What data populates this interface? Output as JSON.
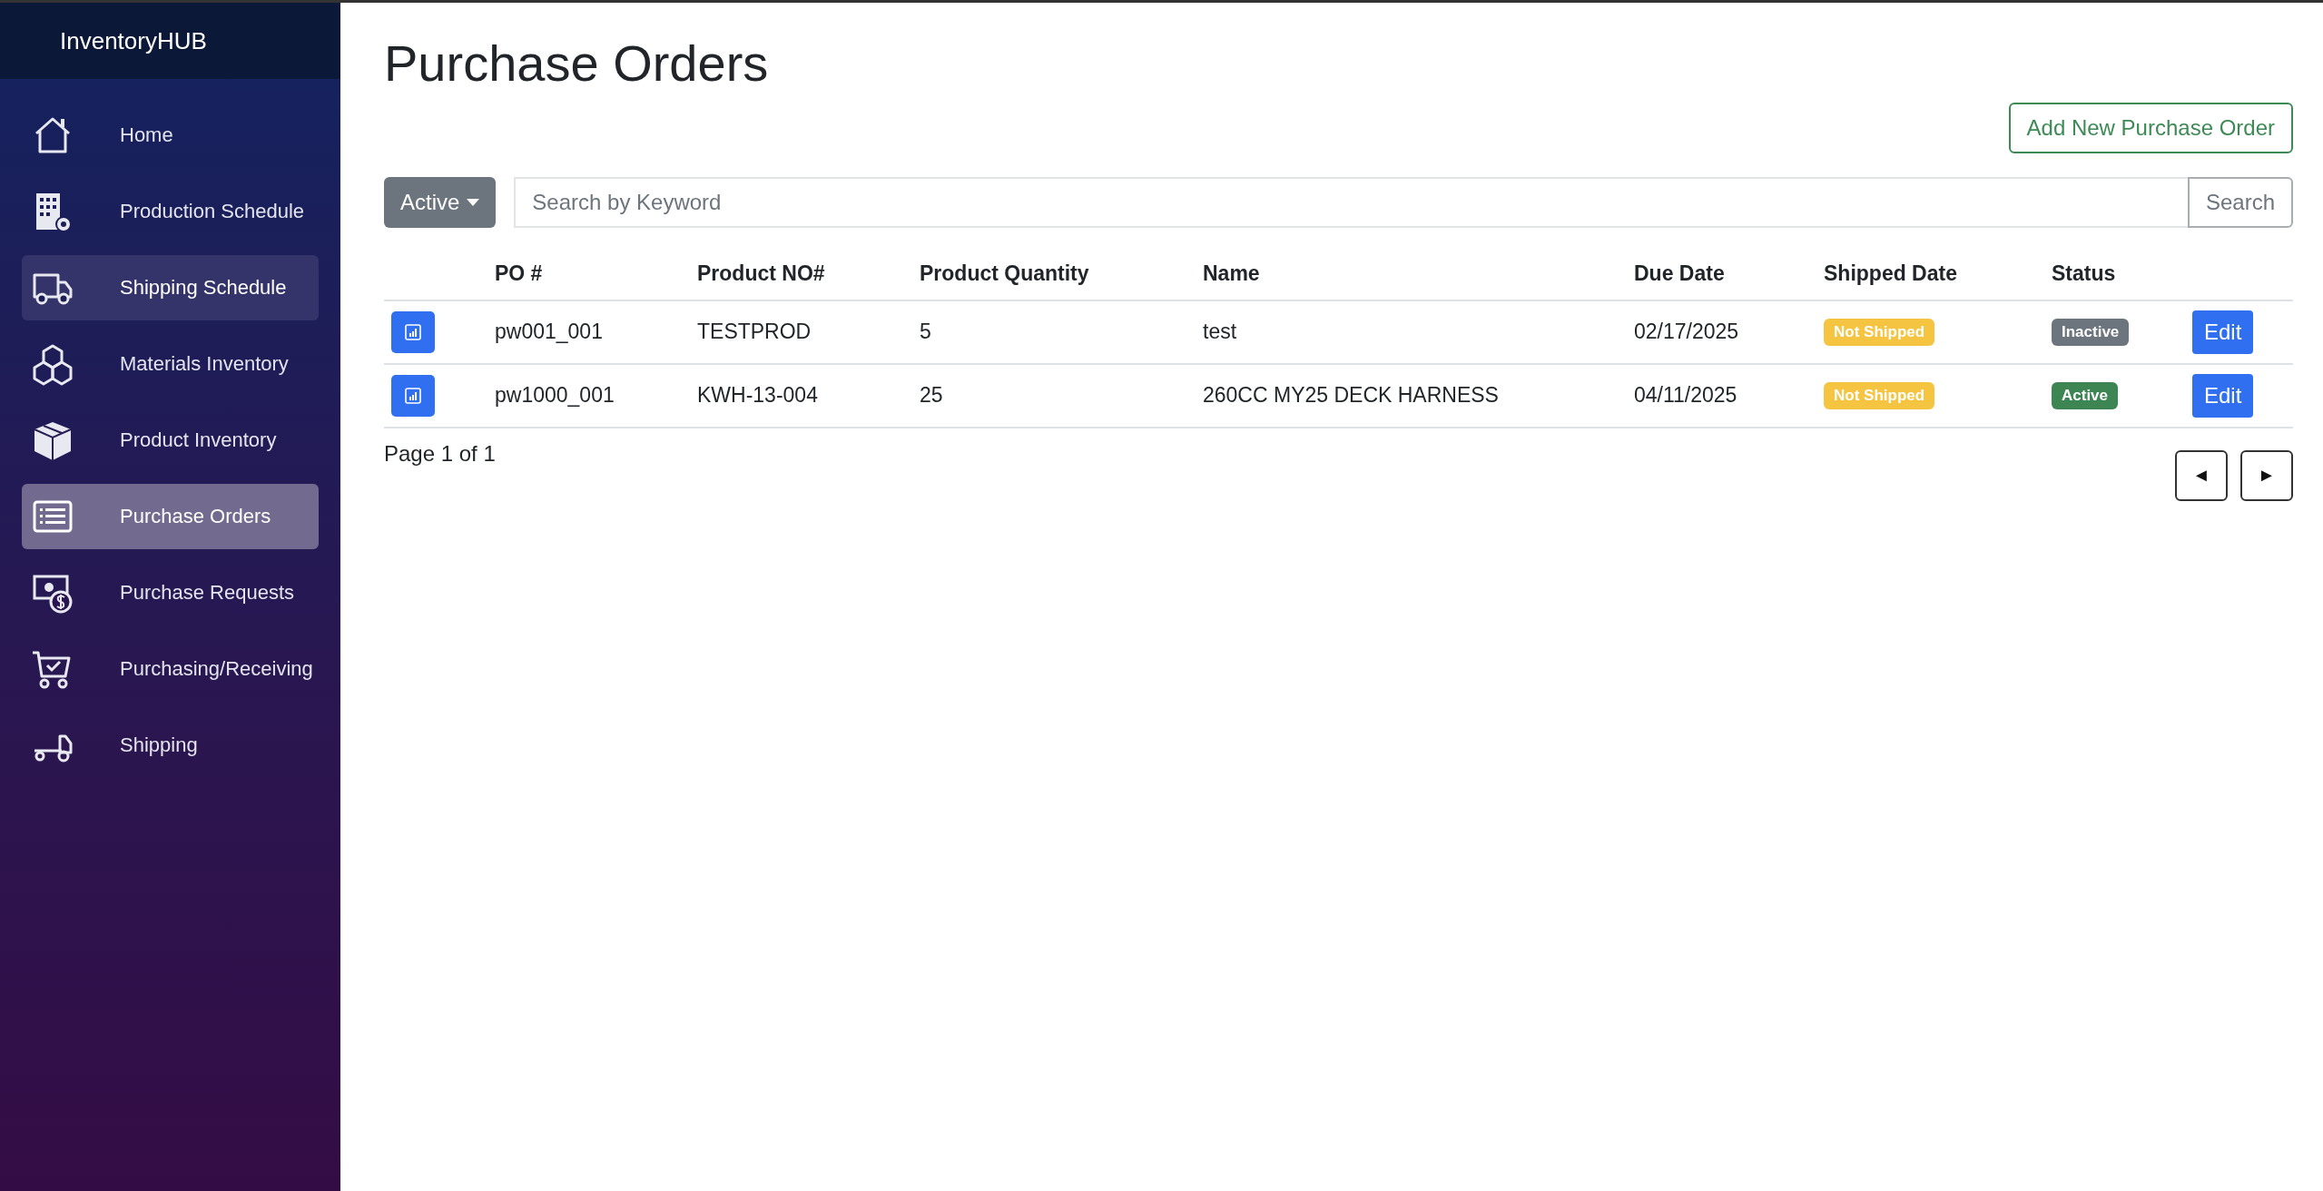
{
  "sidebar": {
    "brand": "InventoryHUB",
    "items": [
      {
        "label": "Home",
        "selected": false,
        "hovered": false
      },
      {
        "label": "Production Schedule",
        "selected": false,
        "hovered": false
      },
      {
        "label": "Shipping Schedule",
        "selected": false,
        "hovered": true
      },
      {
        "label": "Materials Inventory",
        "selected": false,
        "hovered": false
      },
      {
        "label": "Product Inventory",
        "selected": false,
        "hovered": false
      },
      {
        "label": "Purchase Orders",
        "selected": true,
        "hovered": false
      },
      {
        "label": "Purchase Requests",
        "selected": false,
        "hovered": false
      },
      {
        "label": "Purchasing/Receiving",
        "selected": false,
        "hovered": false
      },
      {
        "label": "Shipping",
        "selected": false,
        "hovered": false
      }
    ]
  },
  "page": {
    "title": "Purchase Orders",
    "add_button": "Add New Purchase Order",
    "filter": {
      "label": "Active"
    },
    "search": {
      "placeholder": "Search by Keyword",
      "button": "Search"
    },
    "table": {
      "columns": [
        "PO #",
        "Product NO#",
        "Product Quantity",
        "Name",
        "Due Date",
        "Shipped Date",
        "Status"
      ],
      "rows": [
        {
          "po": "pw001_001",
          "product_no": "TESTPROD",
          "quantity": "5",
          "name": "test",
          "due_date": "02/17/2025",
          "shipped": {
            "text": "Not Shipped",
            "color": "#f5c542"
          },
          "status": {
            "text": "Inactive",
            "color": "#6c757d"
          },
          "action": "Edit"
        },
        {
          "po": "pw1000_001",
          "product_no": "KWH-13-004",
          "quantity": "25",
          "name": "260CC MY25 DECK HARNESS",
          "due_date": "04/11/2025",
          "shipped": {
            "text": "Not Shipped",
            "color": "#f5c542"
          },
          "status": {
            "text": "Active",
            "color": "#3d8654"
          },
          "action": "Edit"
        }
      ]
    },
    "pagination": {
      "text": "Page 1 of 1",
      "prev": "◄",
      "next": "►"
    }
  }
}
